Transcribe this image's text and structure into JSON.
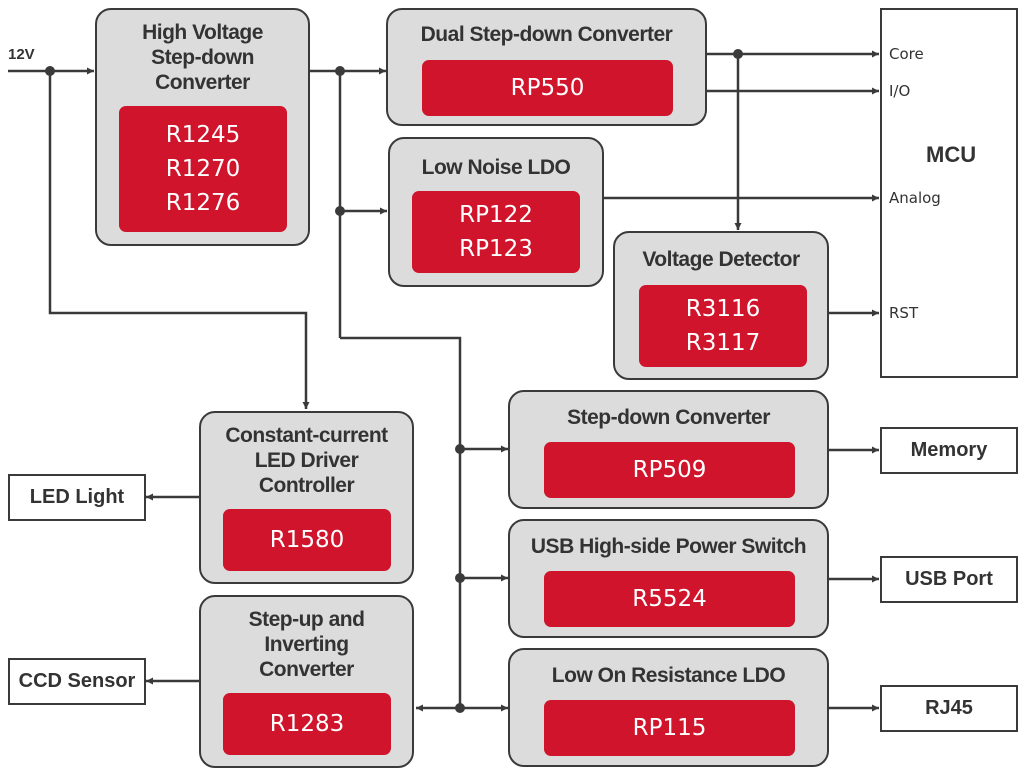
{
  "colors": {
    "block_fill": "#dcdcdc",
    "part_fill": "#cf142b",
    "line": "#3a3a3a",
    "text": "#333333"
  },
  "input": {
    "label": "12V"
  },
  "blocks": {
    "hv_stepdown": {
      "title": [
        "High Voltage",
        "Step-down",
        "Converter"
      ],
      "parts": [
        "R1245",
        "R1270",
        "R1276"
      ]
    },
    "dual_stepdown": {
      "title": [
        "Dual Step-down Converter"
      ],
      "parts": [
        "RP550"
      ]
    },
    "low_noise_ldo": {
      "title": [
        "Low Noise LDO"
      ],
      "parts": [
        "RP122",
        "RP123"
      ]
    },
    "voltage_detector": {
      "title": [
        "Voltage Detector"
      ],
      "parts": [
        "R3116",
        "R3117"
      ]
    },
    "led_driver": {
      "title": [
        "Constant-current",
        "LED Driver",
        "Controller"
      ],
      "parts": [
        "R1580"
      ]
    },
    "stepup_inverting": {
      "title": [
        "Step-up and",
        "Inverting",
        "Converter"
      ],
      "parts": [
        "R1283"
      ]
    },
    "stepdown": {
      "title": [
        "Step-down Converter"
      ],
      "parts": [
        "RP509"
      ]
    },
    "usb_switch": {
      "title": [
        "USB High-side Power Switch"
      ],
      "parts": [
        "R5524"
      ]
    },
    "low_on_ldo": {
      "title": [
        "Low On Resistance LDO"
      ],
      "parts": [
        "RP115"
      ]
    }
  },
  "mcu": {
    "title": "MCU",
    "pins": [
      "Core",
      "I/O",
      "Analog",
      "RST"
    ]
  },
  "endpoints": {
    "led_light": "LED Light",
    "ccd_sensor": "CCD Sensor",
    "memory": "Memory",
    "usb_port": "USB Port",
    "rj45": "RJ45"
  }
}
